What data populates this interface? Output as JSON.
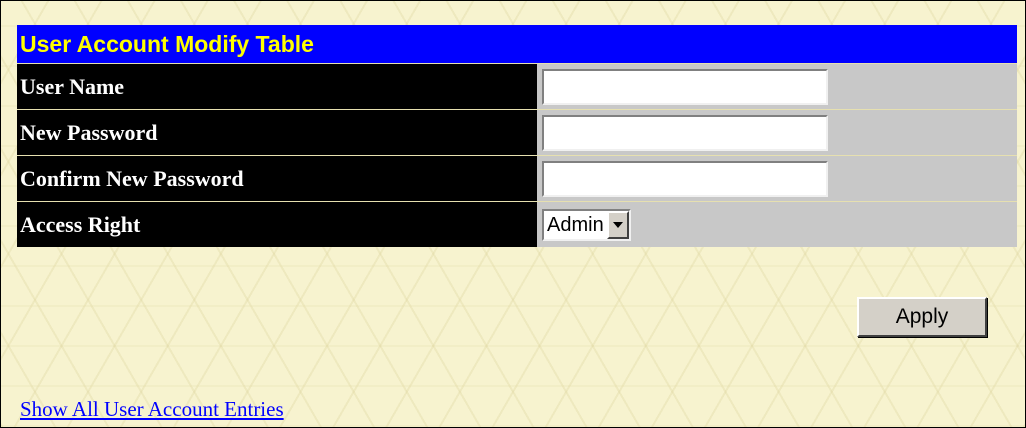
{
  "panel": {
    "title": "User Account Modify Table"
  },
  "fields": [
    {
      "label": "User Name",
      "value": ""
    },
    {
      "label": "New Password",
      "value": ""
    },
    {
      "label": "Confirm New Password",
      "value": ""
    },
    {
      "label": "Access Right",
      "selected": "Admin"
    }
  ],
  "actions": {
    "apply_label": "Apply"
  },
  "links": {
    "show_all": "Show All User Account Entries"
  },
  "colors": {
    "title_bg": "#0000ff",
    "title_text": "#ffff00",
    "label_bg": "#000000",
    "value_bg": "#c8c8c8",
    "page_bg": "#f7f3cf",
    "link": "#0000ff"
  },
  "icons": {
    "select_arrow": "chevron-down-icon"
  }
}
